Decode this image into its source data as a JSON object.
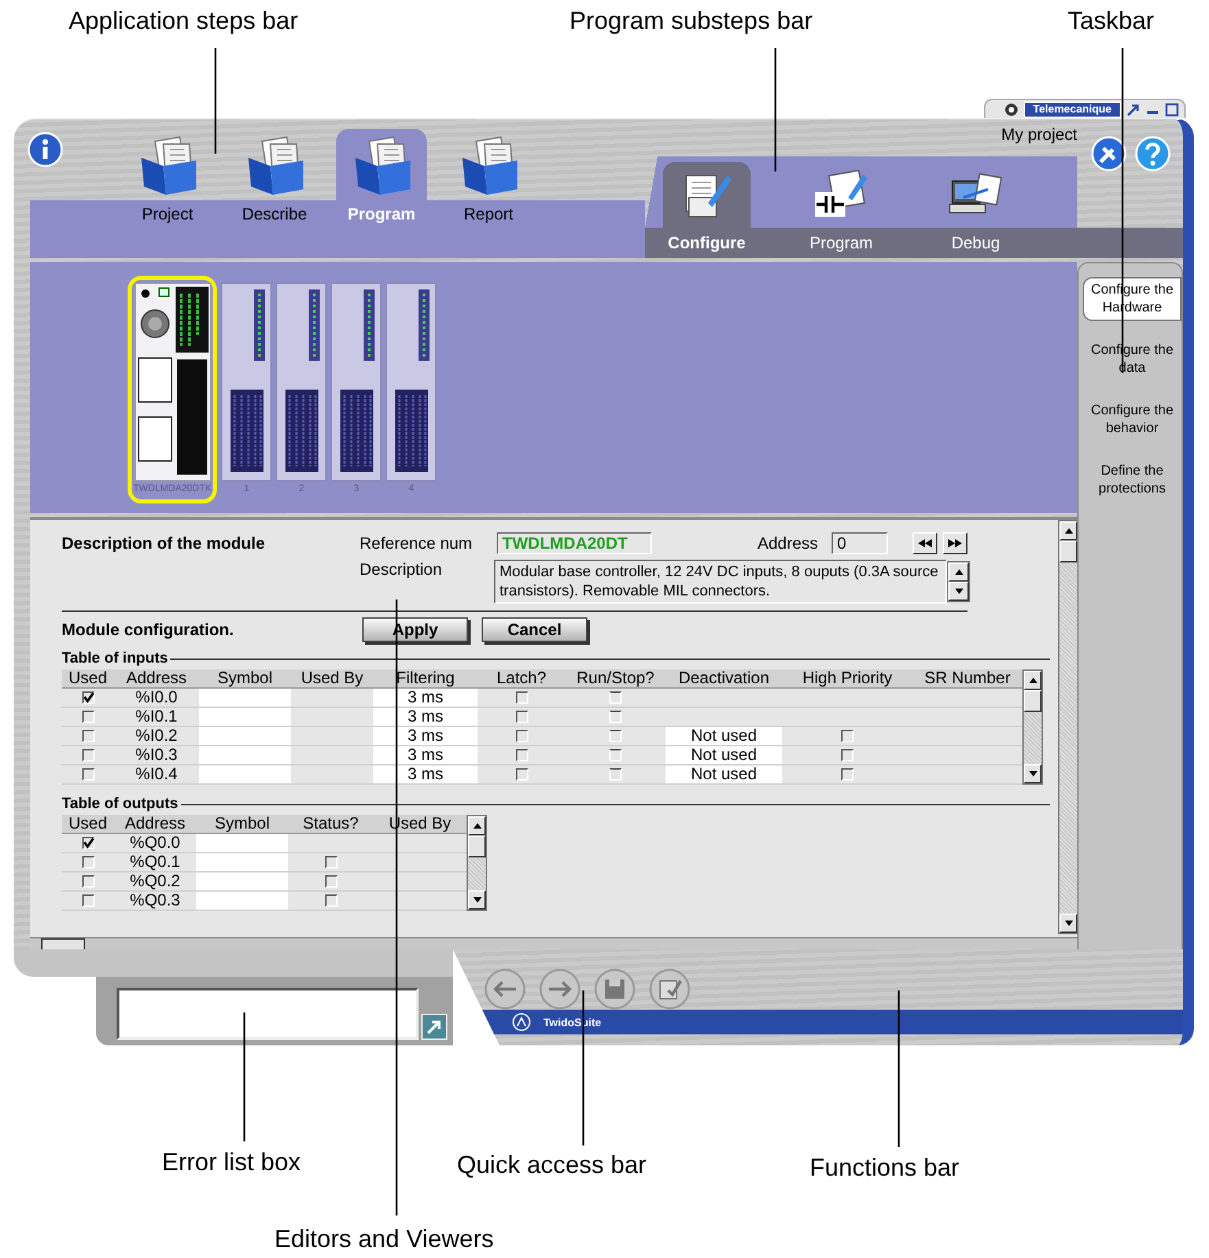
{
  "callouts": [
    {
      "label": "Application steps bar"
    },
    {
      "label": "Program substeps bar"
    },
    {
      "label": "Taskbar"
    },
    {
      "label": "Error list box"
    },
    {
      "label": "Quick access bar"
    },
    {
      "label": "Functions bar"
    },
    {
      "label": "Editors and Viewers"
    }
  ],
  "window": {
    "brand": "Telemecanique",
    "project": "My project",
    "status_text": "TwidoSuite"
  },
  "app_steps": [
    {
      "label": "Project",
      "selected": false
    },
    {
      "label": "Describe",
      "selected": false
    },
    {
      "label": "Program",
      "selected": true
    },
    {
      "label": "Report",
      "selected": false
    }
  ],
  "substeps": [
    {
      "label": "Configure",
      "selected": true
    },
    {
      "label": "Program",
      "selected": false
    },
    {
      "label": "Debug",
      "selected": false
    }
  ],
  "hardware": {
    "modules": [
      {
        "kind": "base",
        "label": "TWDLMDA20DTK",
        "selected": true
      },
      {
        "kind": "expansion",
        "label": "1",
        "selected": false
      },
      {
        "kind": "expansion",
        "label": "2",
        "selected": false
      },
      {
        "kind": "expansion",
        "label": "3",
        "selected": false
      },
      {
        "kind": "expansion",
        "label": "4",
        "selected": false
      }
    ]
  },
  "taskbar": [
    {
      "label": "Configure the Hardware",
      "selected": true
    },
    {
      "label": "Configure the data",
      "selected": false
    },
    {
      "label": "Configure the behavior",
      "selected": false
    },
    {
      "label": "Define the protections",
      "selected": false
    }
  ],
  "module": {
    "title": "Description of the module",
    "reference_label": "Reference num",
    "reference": "TWDLMDA20DT",
    "address_label": "Address",
    "address": "0",
    "description_label": "Description",
    "description": "Modular base controller, 12 24V DC inputs, 8 ouputs (0.3A source transistors). Removable MIL connectors."
  },
  "configuration": {
    "title": "Module configuration.",
    "buttons": [
      {
        "label": "Apply"
      },
      {
        "label": "Cancel"
      }
    ]
  },
  "inputs": {
    "title": "Table of inputs",
    "columns": [
      "Used",
      "Address",
      "Symbol",
      "Used By",
      "Filtering",
      "Latch?",
      "Run/Stop?",
      "Deactivation",
      "High Priority",
      "SR Number"
    ],
    "rows": [
      {
        "used": true,
        "address": "%I0.0",
        "filtering": "3 ms",
        "latch": false,
        "run_stop": false
      },
      {
        "used": false,
        "address": "%I0.1",
        "filtering": "3 ms",
        "latch": false,
        "run_stop": false
      },
      {
        "used": false,
        "address": "%I0.2",
        "filtering": "3 ms",
        "latch": false,
        "run_stop": false,
        "deactivation": "Not used",
        "high_priority": false
      },
      {
        "used": false,
        "address": "%I0.3",
        "filtering": "3 ms",
        "latch": false,
        "run_stop": false,
        "deactivation": "Not used",
        "high_priority": false
      },
      {
        "used": false,
        "address": "%I0.4",
        "filtering": "3 ms",
        "latch": false,
        "run_stop": false,
        "deactivation": "Not used",
        "high_priority": false
      }
    ]
  },
  "outputs": {
    "title": "Table of outputs",
    "columns": [
      "Used",
      "Address",
      "Symbol",
      "Status?",
      "Used By"
    ],
    "rows": [
      {
        "used": true,
        "address": "%Q0.0"
      },
      {
        "used": false,
        "address": "%Q0.1",
        "status": false
      },
      {
        "used": false,
        "address": "%Q0.2",
        "status": false
      },
      {
        "used": false,
        "address": "%Q0.3",
        "status": false
      }
    ]
  }
}
